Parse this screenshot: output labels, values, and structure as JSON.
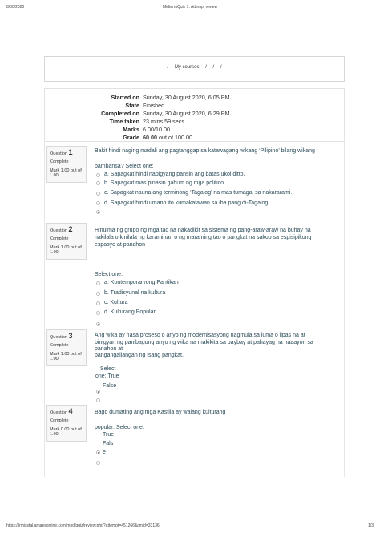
{
  "print_header": {
    "date": "8/30/2020",
    "title": "MidtermQuiz 1: Attempt review"
  },
  "print_footer": {
    "url": "https://lrmisstal.amaesonline.com/mod/quiz/review.php?attempt=451266&cmid=33136",
    "page": "1/3"
  },
  "breadcrumb": {
    "sep": "/",
    "courses": "My courses"
  },
  "summary": {
    "started_on": {
      "label": "Started on",
      "value": "Sunday, 30 August 2020, 6:05 PM"
    },
    "state": {
      "label": "State",
      "value": "Finished"
    },
    "completed_on": {
      "label": "Completed on",
      "value": "Sunday, 30 August 2020, 6:29 PM"
    },
    "time_taken": {
      "label": "Time taken",
      "value": "23 mins 59 secs"
    },
    "marks": {
      "label": "Marks",
      "value": "6.00/10.00"
    },
    "grade": {
      "label": "Grade",
      "value_bold": "60.00",
      "value_rest": "out of 100.00"
    }
  },
  "questions": [
    {
      "q_label": "Question",
      "number": "1",
      "state": "Complete",
      "mark": "Mark 1.00 out of 1.00",
      "text_line1": "Bakit hindi naging madali ang pagtanggap sa katawagang wikang ‘Pilipino’ bilang wikang",
      "text_line2": "pambansa? Select one:",
      "options": [
        "a. Sapagkat hindi nabigyang pansin ang batas ukol ditto.",
        "b. Sapagkat mas pinasin gahum ng mga politico.",
        "c. Sapagkat nauna ang terminong ‘Tagalog’ na mas tumagal sa nakararami.",
        "d. Sapagkat hindi umano ito kumakatawan sa iba pang di-Tagalog."
      ]
    },
    {
      "q_label": "Question",
      "number": "2",
      "state": "Complete",
      "mark": "Mark 1.00 out of 1.00",
      "text_line1": "Hinulma ng grupo ng mga tao na nakadikit sa sistema ng pang-araw-araw na buhay na",
      "text_line2": "nakilala o kinilala ng karamihan o ng maraming tao o pangkat na sakop sa espisipikong",
      "text_line3": "espasyo at panahon",
      "select_one": "Select one:",
      "options": [
        "a. Kontemporaryong Pantikan",
        "b. Tradisyunal na kultura",
        "c. Kultura",
        "d. Kulturang Popular"
      ]
    },
    {
      "q_label": "Question",
      "number": "3",
      "state": "Complete",
      "mark": "Mark 1.00 out of 1.00",
      "text_line1": "Ang wika ay nasa proseso o anyo ng modernisasyong nagmula sa luma o lipas na at",
      "text_line2": "binigyan ng panibagong anyo ng wika na makikita sa baybay at pahayag na naaayon sa",
      "text_line3": "panahon at",
      "text_line4": "pangangailangan ng isang pangkat.",
      "select_a": "Select",
      "select_b": "one: True",
      "options": [
        "False"
      ]
    },
    {
      "q_label": "Question",
      "number": "4",
      "state": "Complete",
      "mark": "Mark 0.00 out of 1.00",
      "text_line1": "Bago dumating ang mga Kastila ay walang kulturang",
      "text_line2": "popular. Select one:",
      "options": [
        "True",
        "Fals",
        "e"
      ]
    }
  ]
}
